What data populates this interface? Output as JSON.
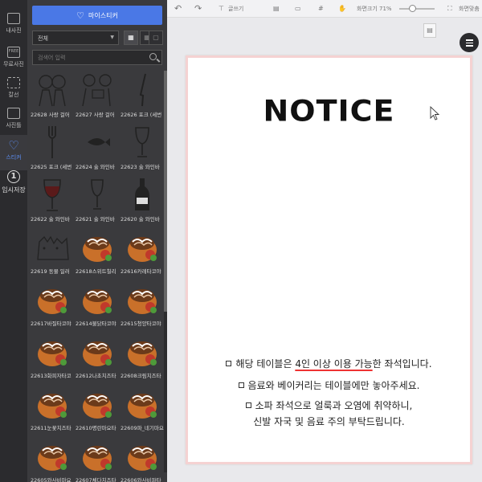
{
  "rail": {
    "items": [
      {
        "label": "내사진",
        "key": "my-photos"
      },
      {
        "label": "무료사진",
        "key": "free-photos"
      },
      {
        "label": "칼선",
        "key": "cut-line"
      },
      {
        "label": "사진틀",
        "key": "photo-frame"
      },
      {
        "label": "스티커",
        "key": "sticker"
      },
      {
        "label": "임시저장",
        "key": "temp-save"
      }
    ],
    "free_badge": "FREE",
    "save_number": "1"
  },
  "panel": {
    "my_sticker_label": "마이스티커",
    "filter_value": "전체",
    "search_placeholder": "검색어 입력",
    "stickers": [
      {
        "caption": "22628 사랑 걸어",
        "kind": "couple"
      },
      {
        "caption": "22627 사랑 걸어",
        "kind": "couple2"
      },
      {
        "caption": "22626 포크 (세번",
        "kind": "knife"
      },
      {
        "caption": "22625 포크 (세번",
        "kind": "fork"
      },
      {
        "caption": "22624 술 와인바",
        "kind": "fish"
      },
      {
        "caption": "22623 술 와인바",
        "kind": "glass"
      },
      {
        "caption": "22622 술 와인바",
        "kind": "wineglass"
      },
      {
        "caption": "22621 술 와인바",
        "kind": "glass2"
      },
      {
        "caption": "22620 술 와인바",
        "kind": "bottle"
      },
      {
        "caption": "22619 동물 일러",
        "kind": "animals"
      },
      {
        "caption": "22618스위트칠리",
        "kind": "tako"
      },
      {
        "caption": "22616카레타코야",
        "kind": "tako"
      },
      {
        "caption": "22617바질타코야",
        "kind": "tako"
      },
      {
        "caption": "22614불닭타코야",
        "kind": "tako"
      },
      {
        "caption": "22615청양타코야",
        "kind": "tako"
      },
      {
        "caption": "22613화피자타코",
        "kind": "tako"
      },
      {
        "caption": "22612나초치즈타",
        "kind": "tako"
      },
      {
        "caption": "22608크림치즈타",
        "kind": "tako"
      },
      {
        "caption": "22611눈꽃치즈타",
        "kind": "tako"
      },
      {
        "caption": "22610명란마요타",
        "kind": "tako"
      },
      {
        "caption": "22609파_네기마요",
        "kind": "tako"
      },
      {
        "caption": "22605와사비마요",
        "kind": "tako"
      },
      {
        "caption": "22607체다치즈타",
        "kind": "tako"
      },
      {
        "caption": "22606와사비파타",
        "kind": "tako"
      }
    ]
  },
  "toolbar": {
    "undo": "↶",
    "redo": "↷",
    "text_label": "글쓰기",
    "zoom_label": "화면크기 71%",
    "fit_label": "화면맞춤"
  },
  "page": {
    "title": "NOTICE",
    "line1_pre": "해당 테이블은 ",
    "line1_hl": "4인 이상 이용 가능",
    "line1_post": "한 좌석입니다.",
    "line2": "음료와 베이커리는 테이블에만 놓아주세요.",
    "line3": "소파 좌석으로 얼룩과 오염에 취약하니,",
    "line4": "신발 자국 및 음료 주의 부탁드립니다."
  },
  "colors": {
    "accent": "#4a78e6",
    "rail_bg": "#2b2b2e",
    "panel_bg": "#3a3a3d",
    "border_pink": "#f5d2d2"
  }
}
